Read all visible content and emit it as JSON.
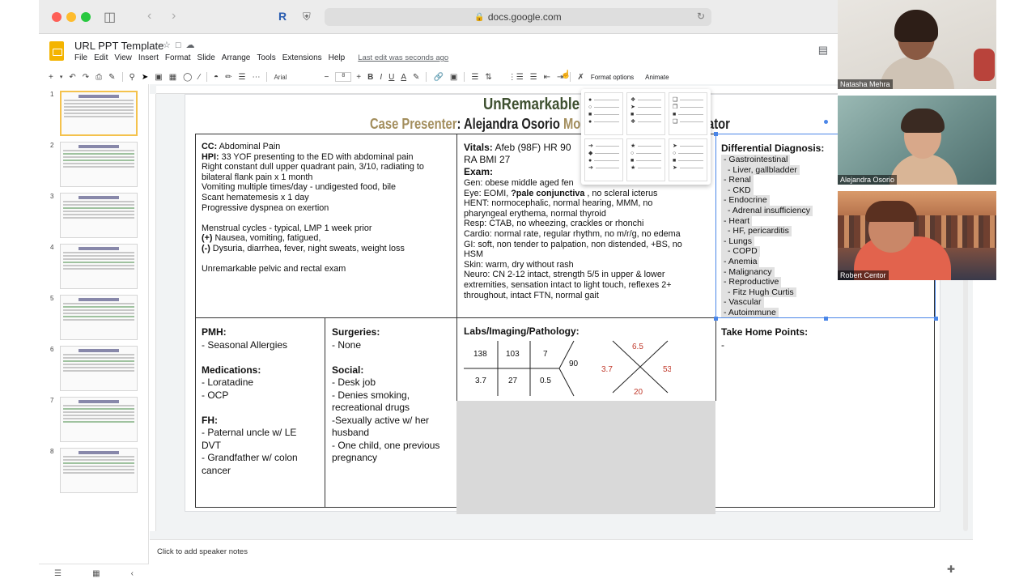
{
  "browser": {
    "url": "docs.google.com",
    "reader_letter": "R"
  },
  "doc": {
    "title": "URL PPT Template",
    "menu": [
      "File",
      "Edit",
      "View",
      "Insert",
      "Format",
      "Slide",
      "Arrange",
      "Tools",
      "Extensions",
      "Help"
    ],
    "last_edit": "Last edit was seconds ago"
  },
  "toolbar": {
    "font": "Arial",
    "font_size": "8",
    "bold": "B",
    "italic": "I",
    "underline": "U",
    "text_color": "A",
    "format_options": "Format options",
    "animate": "Animate"
  },
  "filmstrip": {
    "slides": [
      "1",
      "2",
      "3",
      "4",
      "5",
      "6",
      "7",
      "8"
    ]
  },
  "notes": {
    "placeholder": "Click to add speaker notes"
  },
  "slide": {
    "title": "UnRemarkable",
    "subtitle_label": "Case Presenter",
    "presenter": ": Alejandra Osorio",
    "mod_label": "Mod",
    "sub_end": "ator",
    "cc": {
      "cc_label": "CC:",
      "cc_text": " Abdominal Pain",
      "hpi_label": "HPI:",
      "hpi_text": " 33 YOF presenting to the ED with abdominal pain",
      "lines": [
        "Right constant dull upper quadrant pain, 3/10, radiating to",
        "bilateral flank pain x 1 month",
        "Vomiting multiple times/day - undigested food, bile",
        "Scant hematemesis x 1 day",
        "Progressive dyspnea on exertion"
      ],
      "menstrual": "Menstrual cycles - typical, LMP 1 week prior",
      "pos_label": "(+)",
      "pos_text": " Nausea, vomiting, fatigued,",
      "neg_label": "(-)",
      "neg_text": " Dysuria, diarrhea, fever, night sweats, weight loss",
      "pelvic": "Unremarkable pelvic and rectal exam"
    },
    "vitals": {
      "label": "Vitals:",
      "line1": "  Afeb (98F) HR 90",
      "line2": "RA BMI 27",
      "exam_label": "Exam:",
      "gen": "Gen: obese middle aged fen",
      "eye_a": "Eye: EOMI, ",
      "eye_b": "?pale conjunctiva",
      "eye_c": " , no scleral icterus",
      "rest": [
        "HENT:  normocephalic, normal hearing, MMM, no",
        "pharyngeal erythema, normal thyroid",
        "Resp: CTAB, no wheezing, crackles or rhonchi",
        "Cardio: normal rate, regular rhythm, no m/r/g, no edema",
        "GI: soft, non tender to palpation, non distended, +BS, no",
        "HSM",
        "Skin: warm, dry without rash",
        "Neuro: CN 2-12 intact, strength 5/5 in upper & lower",
        "extremities, sensation intact to light touch,  reflexes 2+",
        "throughout, intact FTN, normal gait"
      ]
    },
    "differential": {
      "heading": "Differential Diagnosis:",
      "items": [
        "- Gastrointestinal",
        " - Liver, gallbladder",
        "- Renal",
        " - CKD",
        "- Endocrine",
        " - Adrenal insufficiency",
        "- Heart",
        " - HF, pericarditis",
        "- Lungs",
        " - COPD",
        "- Anemia",
        "- Malignancy",
        "- Reproductive",
        " - Fitz Hugh Curtis",
        "- Vascular",
        "- Autoimmune"
      ]
    },
    "pmh": {
      "pmh_label": "PMH:",
      "pmh_items": [
        "- Seasonal Allergies"
      ],
      "med_label": "Medications:",
      "med_items": [
        "- Loratadine",
        "- OCP"
      ],
      "fh_label": "FH:",
      "fh_items": [
        "- Paternal uncle w/ LE",
        "DVT",
        "- Grandfather w/ colon",
        "cancer"
      ]
    },
    "surgeries": {
      "surg_label": "Surgeries:",
      "surg_items": [
        "- None"
      ],
      "social_label": "Social:",
      "social_items": [
        "- Desk job",
        "- Denies smoking,",
        "recreational drugs",
        "-Sexually active w/ her",
        "husband",
        "- One child, one previous",
        "pregnancy"
      ]
    },
    "labs": {
      "label": "Labs/Imaging/Pathology:",
      "bmp": [
        "138",
        "103",
        "7",
        "90",
        "3.7",
        "27",
        "0.5"
      ],
      "cbc": [
        "6.5",
        "3.7",
        "53",
        "20"
      ]
    },
    "take_home": {
      "label": "Take Home Points:",
      "text": "-"
    }
  },
  "participants": [
    {
      "name": "Natasha Mehra"
    },
    {
      "name": "Alejandra Osorio"
    },
    {
      "name": "Robert Centor"
    }
  ],
  "colors": {
    "title_green": "#3e5030",
    "presenter_gold": "#a38e5d",
    "lab_red": "#c0392b",
    "selection_blue": "#4a86e8",
    "slides_yellow": "#f4b400"
  }
}
